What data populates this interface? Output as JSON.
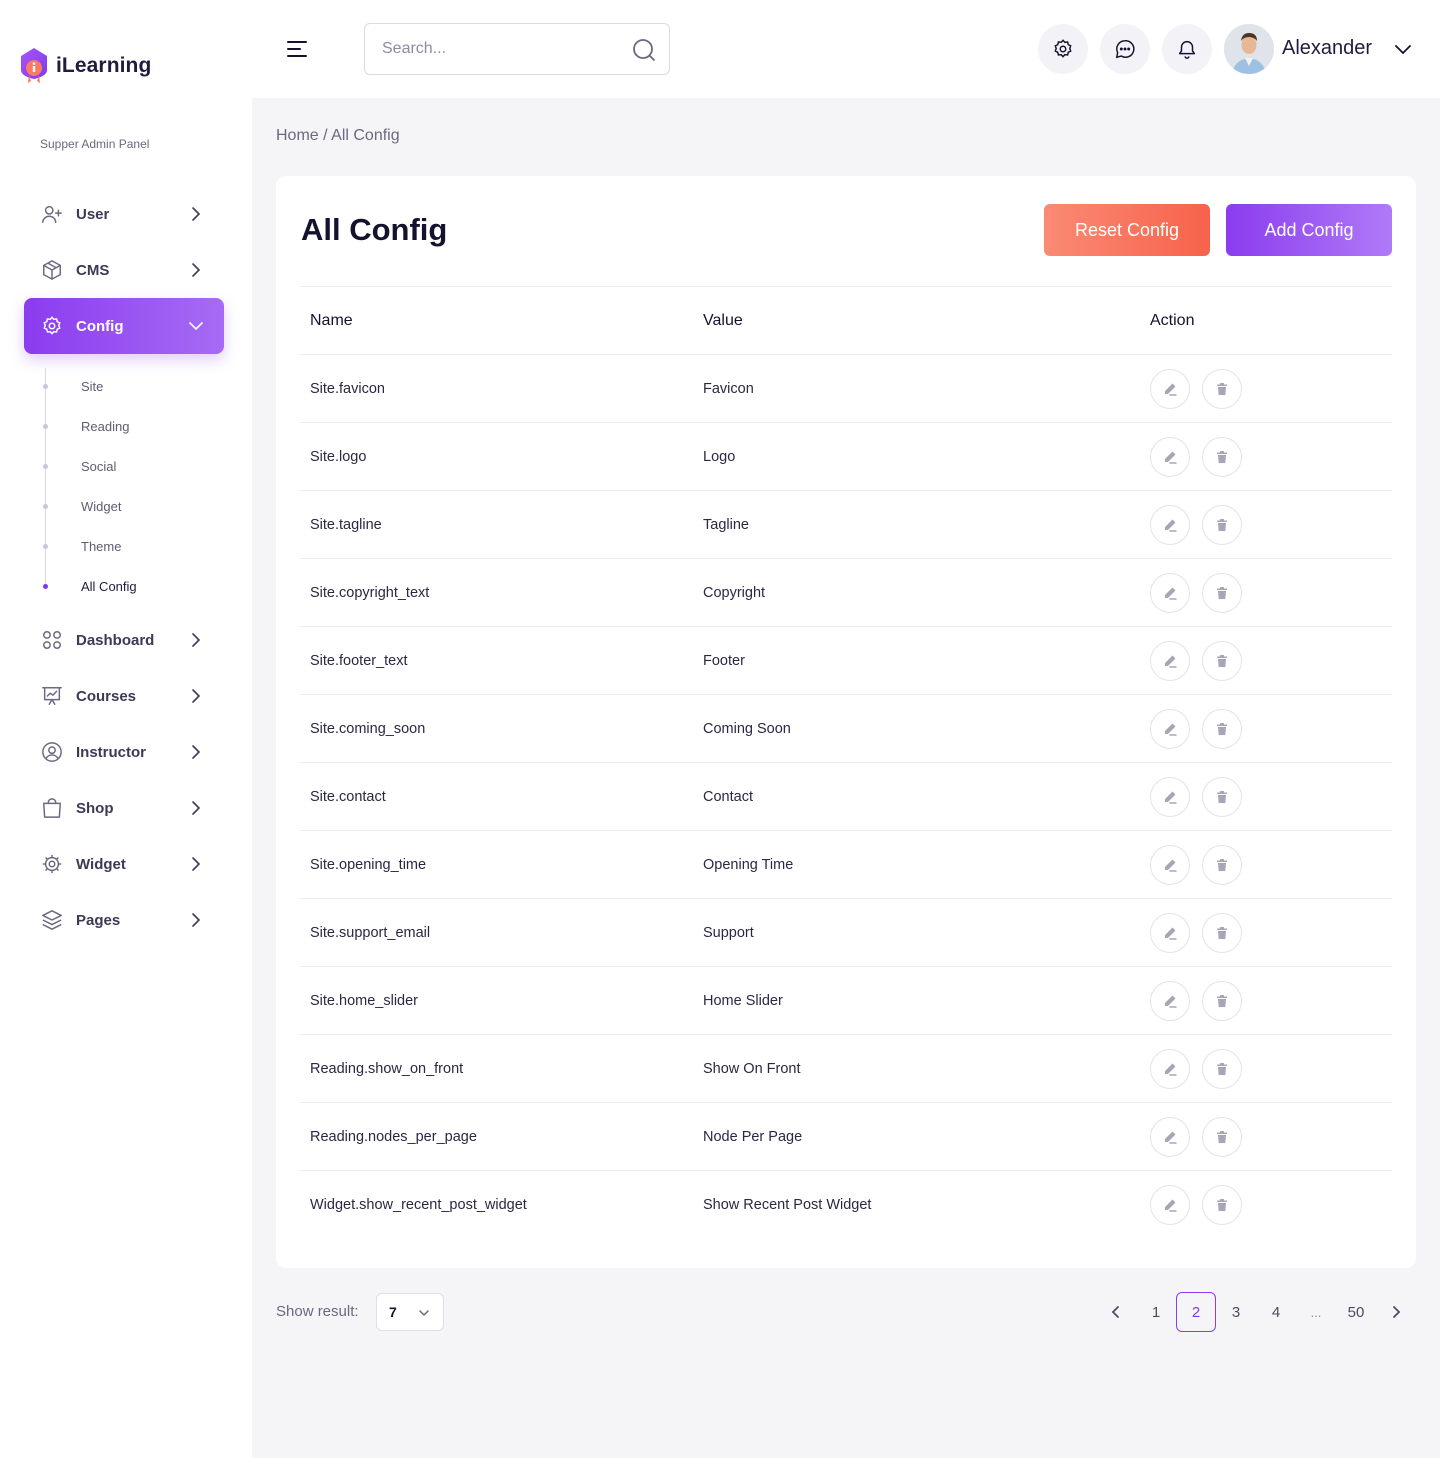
{
  "brand": {
    "name": "iLearning"
  },
  "sidebar": {
    "panel_label": "Supper Admin Panel",
    "items": [
      {
        "label": "User",
        "icon": "user-add-icon"
      },
      {
        "label": "CMS",
        "icon": "box-icon"
      },
      {
        "label": "Config",
        "icon": "gear-icon",
        "active": true
      },
      {
        "label": "Dashboard",
        "icon": "grid-icon"
      },
      {
        "label": "Courses",
        "icon": "presentation-icon"
      },
      {
        "label": "Instructor",
        "icon": "user-circle-icon"
      },
      {
        "label": "Shop",
        "icon": "shopping-bag-icon"
      },
      {
        "label": "Widget",
        "icon": "cog-wheel-icon"
      },
      {
        "label": "Pages",
        "icon": "layers-icon"
      }
    ],
    "config_sub": [
      "Site",
      "Reading",
      "Social",
      "Widget",
      "Theme",
      "All Config"
    ],
    "config_sub_current": "All Config"
  },
  "header": {
    "search_placeholder": "Search...",
    "username": "Alexander"
  },
  "breadcrumb": {
    "home": "Home",
    "separator": " / ",
    "current": "All Config"
  },
  "card": {
    "title": "All Config",
    "reset_label": "Reset Config",
    "add_label": "Add Config"
  },
  "table": {
    "headers": {
      "name": "Name",
      "value": "Value",
      "action": "Action"
    },
    "rows": [
      {
        "name": "Site.favicon",
        "value": "Favicon"
      },
      {
        "name": "Site.logo",
        "value": "Logo"
      },
      {
        "name": "Site.tagline",
        "value": "Tagline"
      },
      {
        "name": "Site.copyright_text",
        "value": "Copyright"
      },
      {
        "name": "Site.footer_text",
        "value": "Footer"
      },
      {
        "name": "Site.coming_soon",
        "value": "Coming Soon"
      },
      {
        "name": "Site.contact",
        "value": "Contact"
      },
      {
        "name": "Site.opening_time",
        "value": "Opening Time"
      },
      {
        "name": "Site.support_email",
        "value": "Support"
      },
      {
        "name": "Site.home_slider",
        "value": "Home Slider"
      },
      {
        "name": "Reading.show_on_front",
        "value": "Show On Front"
      },
      {
        "name": "Reading.nodes_per_page",
        "value": "Node Per Page"
      },
      {
        "name": "Widget.show_recent_post_widget",
        "value": "Show Recent Post Widget"
      }
    ]
  },
  "footer": {
    "show_result_label": "Show result:",
    "show_result_value": "7",
    "pages": [
      "1",
      "2",
      "3",
      "4",
      "...",
      "50"
    ],
    "current_page": "2"
  },
  "colors": {
    "accent": "#8b3cef",
    "reset": "#f7624b",
    "background": "#f5f5f7"
  }
}
